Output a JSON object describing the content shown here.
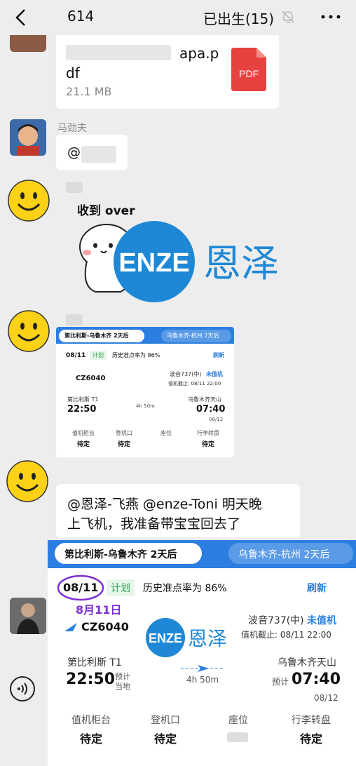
{
  "header": {
    "chat_id": "614",
    "title": "已出生(15)",
    "icons": [
      "back-chevron-icon",
      "mute-bell-icon",
      "more-dots-icon"
    ]
  },
  "messages": {
    "file": {
      "name_part1": "apa.p",
      "name_part2": "df",
      "size": "21.1 MB",
      "badge": "PDF"
    },
    "mention": {
      "sender": "马劲夫",
      "text": "@"
    },
    "sticker": {
      "caption": "收到 over"
    },
    "text_msg": {
      "line1": "@恩泽-飞燕  @enze-Toni  明天晚",
      "line2": "上飞机，我准备带宝宝回去了"
    }
  },
  "watermark": {
    "logo": "ENZE",
    "cn": "恩泽"
  },
  "flight_card": {
    "tab1": "第比利斯-乌鲁木齐 2天后",
    "tab2": "乌鲁木齐-杭州 2天后",
    "date": "08/11",
    "plan": "计划",
    "history": "历史准点率为 86%",
    "refresh": "刷新",
    "aircraft": "波音737(中)",
    "checkin": "未值机",
    "deadline": "值机截止: 08/11 22:00",
    "flight_no": "CZ6040",
    "dep_airport": "第比利斯 T1",
    "dep_time": "22:50",
    "dep_note_1": "预计",
    "dep_note_2": "当地",
    "duration": "4h 50m",
    "arr_airport": "乌鲁木齐天山",
    "arr_note": "预计",
    "arr_time": "07:40",
    "arr_date": "08/12",
    "cols": [
      {
        "h": "值机柜台",
        "v": "待定"
      },
      {
        "h": "登机口",
        "v": "待定"
      },
      {
        "h": "座位",
        "v": ""
      },
      {
        "h": "行李转盘",
        "v": "待定"
      }
    ]
  },
  "annotation": "8月11日",
  "colors": {
    "bg": "#ededed",
    "accent": "#2c7fe0",
    "green": "#2da44e",
    "purple": "#7b2fd2"
  }
}
